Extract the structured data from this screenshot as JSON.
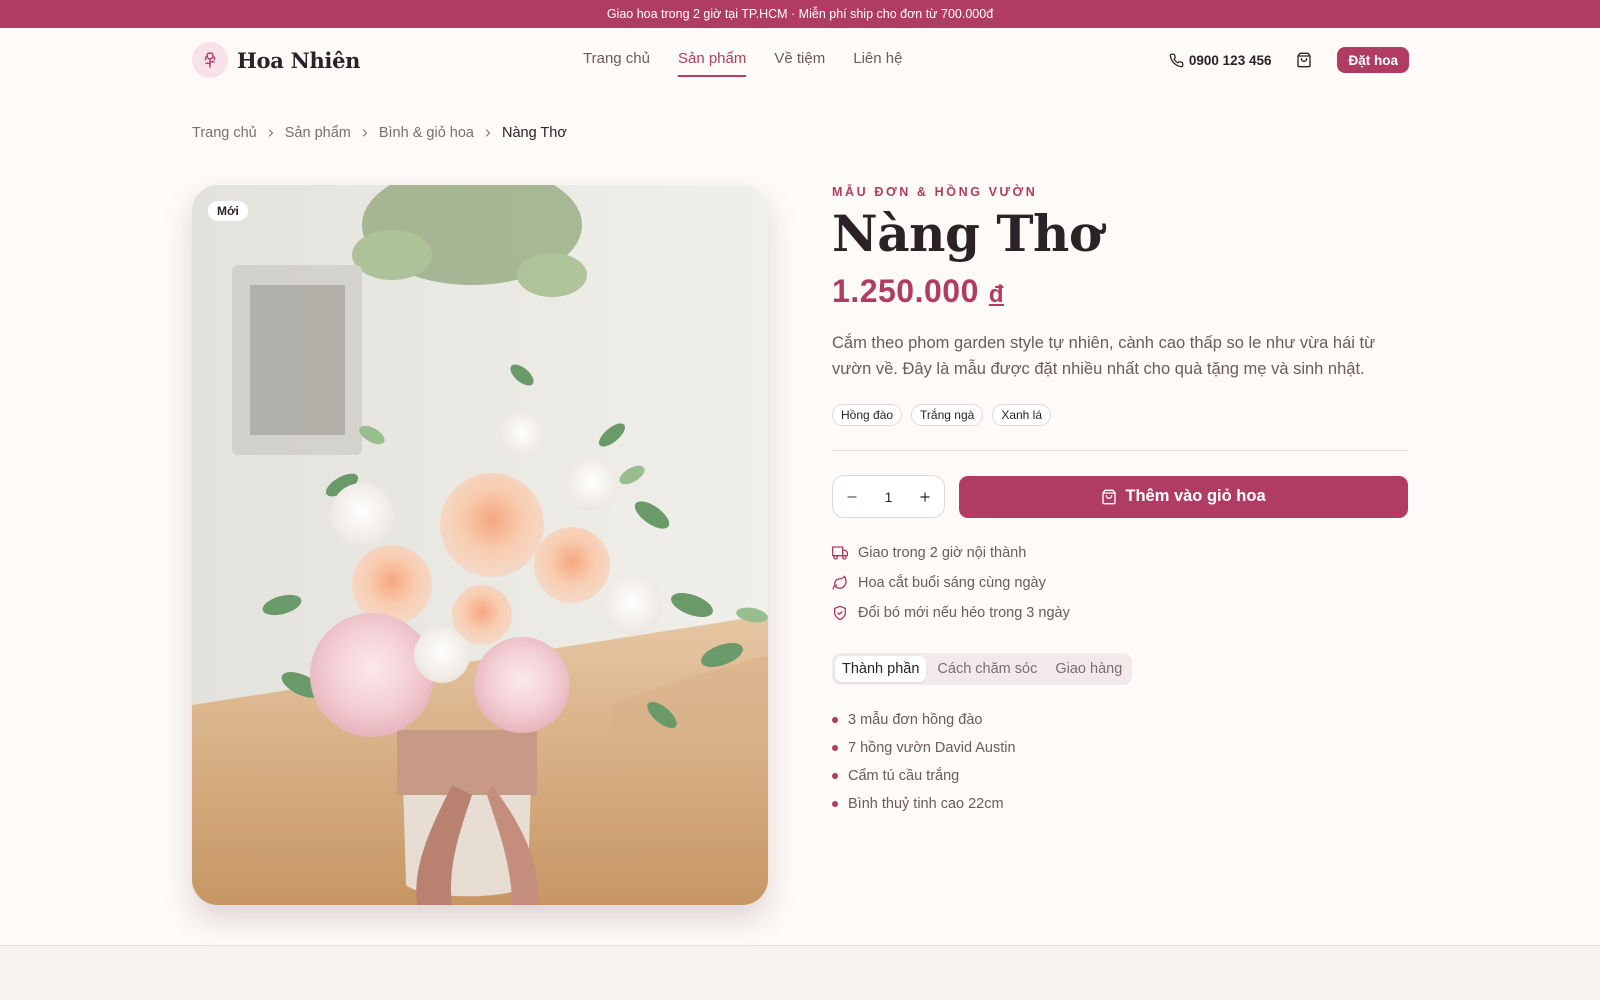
{
  "announcement": "Giao hoa trong 2 giờ tại TP.HCM · Miễn phí ship cho đơn từ 700.000đ",
  "brand": {
    "name": "Hoa Nhiên",
    "logo_icon": "flower-icon"
  },
  "nav": [
    {
      "label": "Trang chủ",
      "active": false
    },
    {
      "label": "Sản phẩm",
      "active": true
    },
    {
      "label": "Về tiệm",
      "active": false
    },
    {
      "label": "Liên hệ",
      "active": false
    }
  ],
  "header": {
    "phone": "0900 123 456",
    "order_label": "Đặt hoa"
  },
  "breadcrumb": [
    "Trang chủ",
    "Sản phẩm",
    "Bình & giỏ hoa",
    "Nàng Thơ"
  ],
  "product": {
    "badge": "Mới",
    "eyebrow": "MẪU ĐƠN & HỒNG VƯỜN",
    "title": "Nàng Thơ",
    "price": "1.250.000",
    "currency": "đ",
    "description": "Cắm theo phom garden style tự nhiên, cành cao thấp so le như vừa hái từ vườn về. Đây là mẫu được đặt nhiều nhất cho quà tặng mẹ và sinh nhật.",
    "colors": [
      "Hồng đào",
      "Trắng ngà",
      "Xanh lá"
    ],
    "quantity": "1",
    "add_to_cart": "Thêm vào giỏ hoa",
    "perks": [
      {
        "icon": "truck-icon",
        "text": "Giao trong 2 giờ nội thành"
      },
      {
        "icon": "leaf-icon",
        "text": "Hoa cắt buổi sáng cùng ngày"
      },
      {
        "icon": "shield-check-icon",
        "text": "Đổi bó mới nếu héo trong 3 ngày"
      }
    ],
    "tabs": [
      {
        "label": "Thành phần",
        "active": true
      },
      {
        "label": "Cách chăm sóc",
        "active": false
      },
      {
        "label": "Giao hàng",
        "active": false
      }
    ],
    "ingredients": [
      "3 mẫu đơn hồng đào",
      "7 hồng vườn David Austin",
      "Cẩm tú cầu trắng",
      "Bình thuỷ tinh cao 22cm"
    ]
  },
  "colors": {
    "accent": "#b03c63",
    "background": "#fdfaf8",
    "text": "#2a2224",
    "muted": "#6b5a5e"
  }
}
